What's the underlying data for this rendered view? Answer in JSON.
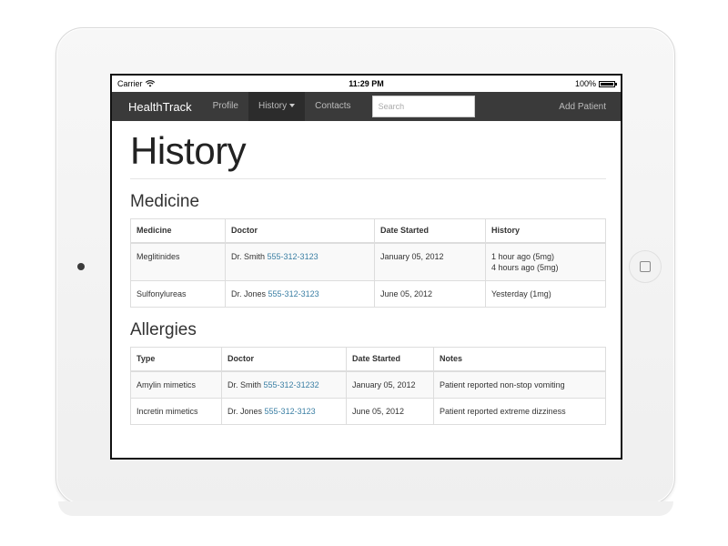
{
  "status_bar": {
    "carrier": "Carrier",
    "time": "11:29 PM",
    "battery": "100%",
    "battery_level": 1.0
  },
  "navbar": {
    "brand": "HealthTrack",
    "items": [
      {
        "label": "Profile"
      },
      {
        "label": "History"
      },
      {
        "label": "Contacts"
      }
    ],
    "search_placeholder": "Search",
    "right_link": "Add Patient"
  },
  "page": {
    "title": "History"
  },
  "medicine": {
    "title": "Medicine",
    "headers": [
      "Medicine",
      "Doctor",
      "Date Started",
      "History"
    ],
    "rows": [
      {
        "medicine": "Meglitinides",
        "doctor": "Dr. Smith",
        "phone": "555-312-3123",
        "date": "January 05, 2012",
        "history_1": "1 hour ago (5mg)",
        "history_2": "4 hours ago (5mg)"
      },
      {
        "medicine": "Sulfonylureas",
        "doctor": "Dr. Jones",
        "phone": "555-312-3123",
        "date": "June 05, 2012",
        "history_1": "Yesterday (1mg)",
        "history_2": ""
      }
    ]
  },
  "allergies": {
    "title": "Allergies",
    "headers": [
      "Type",
      "Doctor",
      "Date Started",
      "Notes"
    ],
    "rows": [
      {
        "type": "Amylin mimetics",
        "doctor": "Dr. Smith",
        "phone": "555-312-31232",
        "date": "January 05, 2012",
        "notes": "Patient reported non-stop vomiting"
      },
      {
        "type": "Incretin mimetics",
        "doctor": "Dr. Jones",
        "phone": "555-312-3123",
        "date": "June 05, 2012",
        "notes": "Patient reported extreme dizziness"
      }
    ]
  },
  "colors": {
    "navbar_bg": "#3a3a3a",
    "link": "#3b7fa4"
  }
}
